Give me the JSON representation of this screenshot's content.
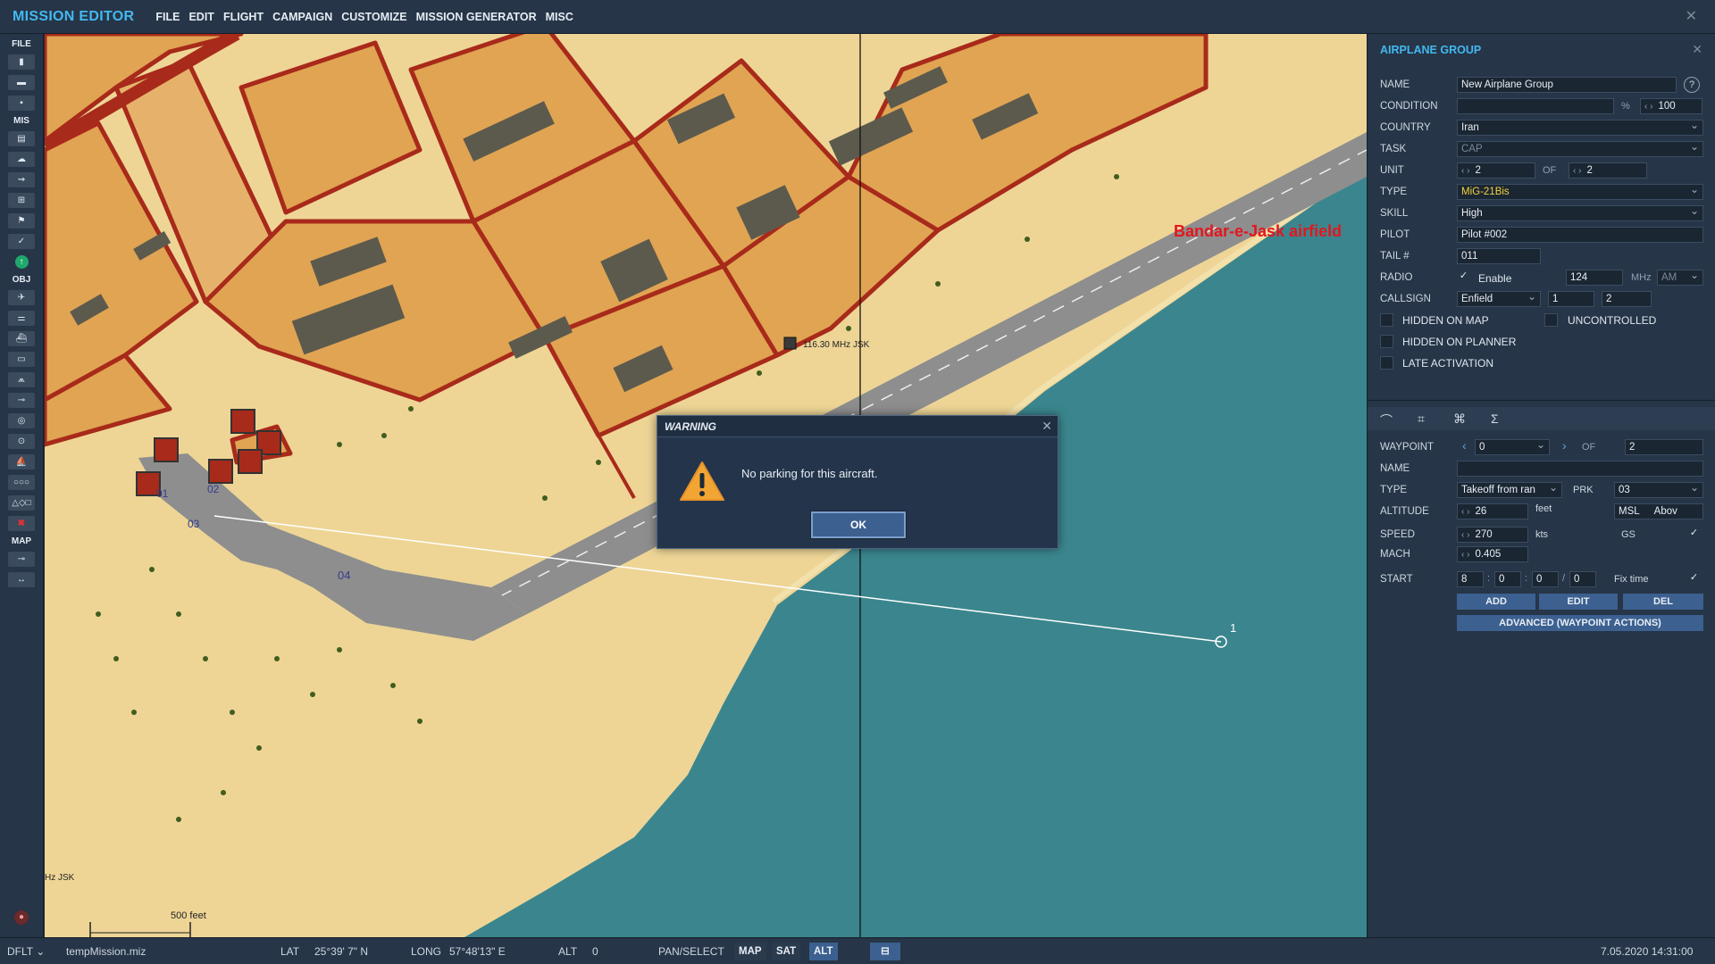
{
  "app": {
    "title": "MISSION EDITOR",
    "close_glyph": "✕"
  },
  "menu": [
    "FILE",
    "EDIT",
    "FLIGHT",
    "CAMPAIGN",
    "CUSTOMIZE",
    "MISSION GENERATOR",
    "MISC"
  ],
  "toolbar": {
    "file_label": "FILE",
    "mis_label": "MIS",
    "obj_label": "OBJ",
    "map_label": "MAP"
  },
  "map": {
    "airfield_label": "Bandar-e-Jask airfield",
    "beacon_label": "116.30 MHz JSK",
    "edge_label": "Hz JSK",
    "scale_label": "500 feet",
    "parking": [
      "01",
      "02",
      "03",
      "04"
    ],
    "waypoint_number": "1"
  },
  "panel": {
    "title": "AIRPLANE GROUP",
    "labels": {
      "name": "NAME",
      "condition": "CONDITION",
      "country": "COUNTRY",
      "task": "TASK",
      "unit": "UNIT",
      "type": "TYPE",
      "skill": "SKILL",
      "pilot": "PILOT",
      "tail": "TAIL #",
      "radio": "RADIO",
      "callsign": "CALLSIGN",
      "of": "OF",
      "enable": "Enable",
      "percent": "%",
      "mhz": "MHz"
    },
    "name_value": "New Airplane Group",
    "help": "?",
    "condition_value": "",
    "condition_pct": "100",
    "country": "Iran",
    "task": "CAP",
    "unit_value": "2",
    "unit_of": "2",
    "type": "MiG-21Bis",
    "skill": "High",
    "pilot": "Pilot #002",
    "tail": "011",
    "radio_freq": "124",
    "radio_mod": "AM",
    "callsign_name": "Enfield",
    "callsign_1": "1",
    "callsign_2": "2",
    "checks": {
      "hidden_map": "HIDDEN ON MAP",
      "uncontrolled": "UNCONTROLLED",
      "hidden_planner": "HIDDEN ON PLANNER",
      "late_activation": "LATE ACTIVATION"
    },
    "waypoint": {
      "labels": {
        "waypoint": "WAYPOINT",
        "of": "OF",
        "name": "NAME",
        "type": "TYPE",
        "prk": "PRK",
        "altitude": "ALTITUDE",
        "speed": "SPEED",
        "mach": "MACH",
        "start": "START"
      },
      "index": "0",
      "of": "2",
      "name": "",
      "type": "Takeoff from ran",
      "prk": "03",
      "altitude": "26",
      "altitude_unit": "feet",
      "alt_ref": "MSL",
      "alt_mode": "Abov",
      "speed": "270",
      "speed_unit": "kts",
      "gs": "GS",
      "mach": "0.405",
      "start_h": "8",
      "start_m": "0",
      "start_s": "0",
      "start_d": "0",
      "fix_time": "Fix time",
      "add": "ADD",
      "edit": "EDIT",
      "del": "DEL",
      "advanced": "ADVANCED (WAYPOINT ACTIONS)"
    }
  },
  "dialog": {
    "title": "WARNING",
    "message": "No parking for this aircraft.",
    "ok": "OK"
  },
  "status": {
    "profile": "DFLT",
    "file": "tempMission.miz",
    "lat_label": "LAT",
    "lat": "25°39' 7\" N",
    "long_label": "LONG",
    "long": "57°48'13\" E",
    "alt_label": "ALT",
    "alt": "0",
    "pan": "PAN/SELECT",
    "map_btn": "MAP",
    "sat_btn": "SAT",
    "alt_btn": "ALT",
    "datetime": "7.05.2020 14:31:00"
  },
  "colors": {
    "accent": "#43b8f0",
    "sand": "#eed596",
    "urban": "#e0a453",
    "road": "#a82a1a",
    "sea": "#3b868e",
    "runway": "#8e8e8e",
    "airfield_text": "#e4161d",
    "type_text": "#f2d23c"
  }
}
